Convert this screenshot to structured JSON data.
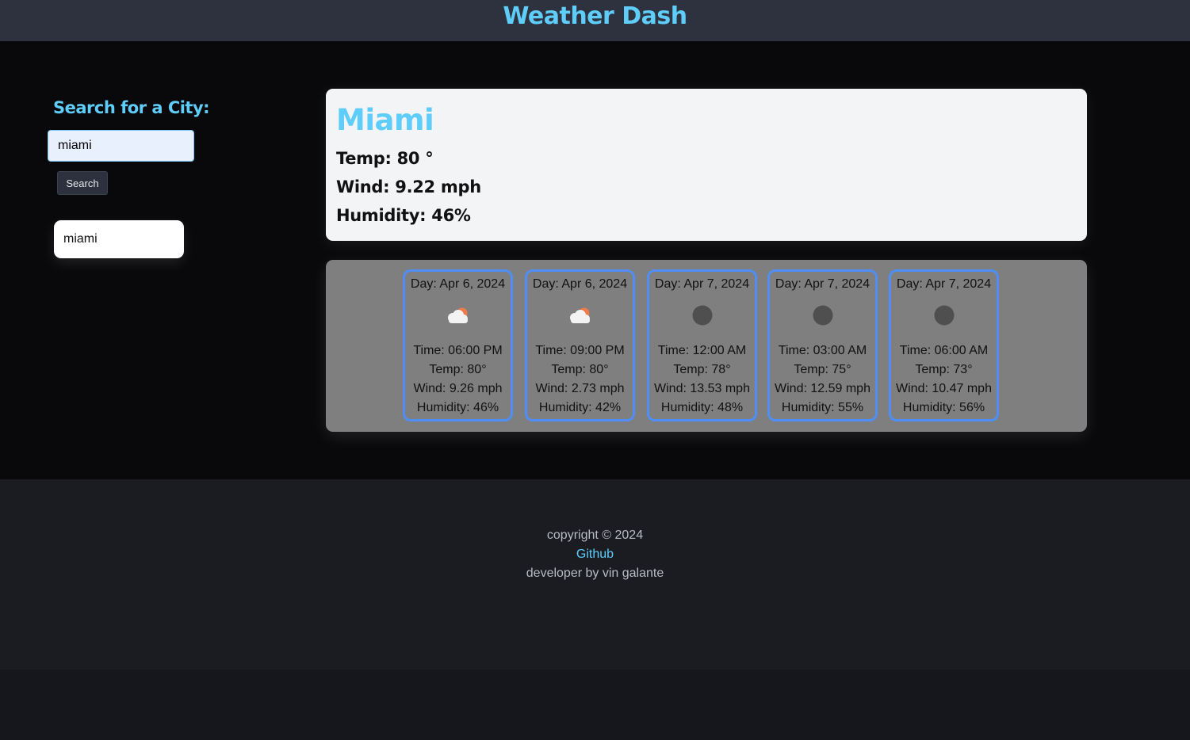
{
  "header": {
    "title": "Weather Dash"
  },
  "search": {
    "heading": "Search for a City:",
    "input_value": "miami",
    "button_label": "Search",
    "history": [
      "miami"
    ]
  },
  "current": {
    "city": "Miami",
    "temp": "Temp: 80 °",
    "wind": "Wind: 9.22 mph",
    "humidity": "Humidity: 46%"
  },
  "forecast": [
    {
      "day": "Day: Apr 6, 2024",
      "icon": "partly-cloudy-sun-icon",
      "time": "Time: 06:00 PM",
      "temp": "Temp: 80°",
      "wind": "Wind: 9.26 mph",
      "humidity": "Humidity: 46%"
    },
    {
      "day": "Day: Apr 6, 2024",
      "icon": "partly-cloudy-sun-icon",
      "time": "Time: 09:00 PM",
      "temp": "Temp: 80°",
      "wind": "Wind: 2.73 mph",
      "humidity": "Humidity: 42%"
    },
    {
      "day": "Day: Apr 7, 2024",
      "icon": "dark-dot-icon",
      "time": "Time: 12:00 AM",
      "temp": "Temp: 78°",
      "wind": "Wind: 13.53 mph",
      "humidity": "Humidity: 48%"
    },
    {
      "day": "Day: Apr 7, 2024",
      "icon": "dark-dot-icon",
      "time": "Time: 03:00 AM",
      "temp": "Temp: 75°",
      "wind": "Wind: 12.59 mph",
      "humidity": "Humidity: 55%"
    },
    {
      "day": "Day: Apr 7, 2024",
      "icon": "dark-dot-icon",
      "time": "Time: 06:00 AM",
      "temp": "Temp: 73°",
      "wind": "Wind: 10.47 mph",
      "humidity": "Humidity: 56%"
    }
  ],
  "footer": {
    "copyright": "copyright © 2024",
    "link_label": "Github",
    "credit": "developer by vin galante"
  },
  "colors": {
    "accent": "#5fcdf9",
    "card_border": "#4f8ef7",
    "header_bg": "#2e323f",
    "main_bg": "#09090c",
    "panel_bg": "#7f7f7f"
  }
}
